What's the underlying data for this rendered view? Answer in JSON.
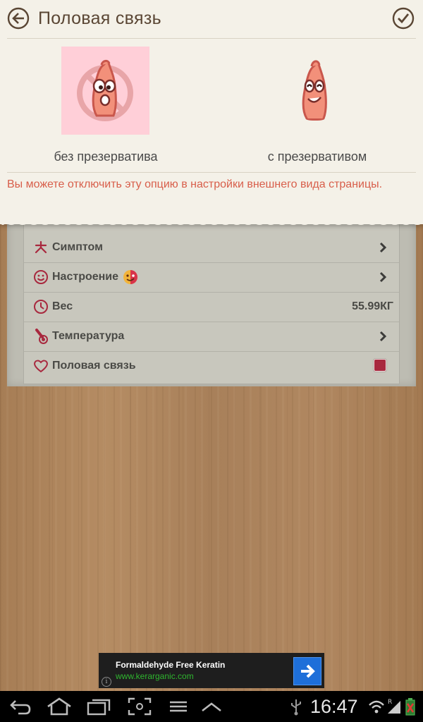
{
  "popup": {
    "title": "Половая связь",
    "option_without": "без презерватива",
    "option_with": "с презервативом",
    "notice": "Вы можете отключить эту опцию в настройки внешнего вида страницы."
  },
  "list": {
    "items": [
      {
        "label": "Симптом",
        "icon": "asterisk-icon"
      },
      {
        "label": "Настроение",
        "icon": "smiley-icon"
      },
      {
        "label": "Вес",
        "icon": "clock-icon",
        "value": "55.99КГ"
      },
      {
        "label": "Температура",
        "icon": "thermometer-icon"
      },
      {
        "label": "Половая связь",
        "icon": "heart-icon"
      }
    ]
  },
  "ad": {
    "title": "Formaldehyde Free Keratin",
    "url": "www.kerarganic.com",
    "info": "i"
  },
  "status_bar": {
    "time": "16:47"
  },
  "colors": {
    "title": "#5a4634",
    "notice": "#d85e4a",
    "accent": "#a8283e",
    "selected_bg": "#ffcfd8"
  }
}
